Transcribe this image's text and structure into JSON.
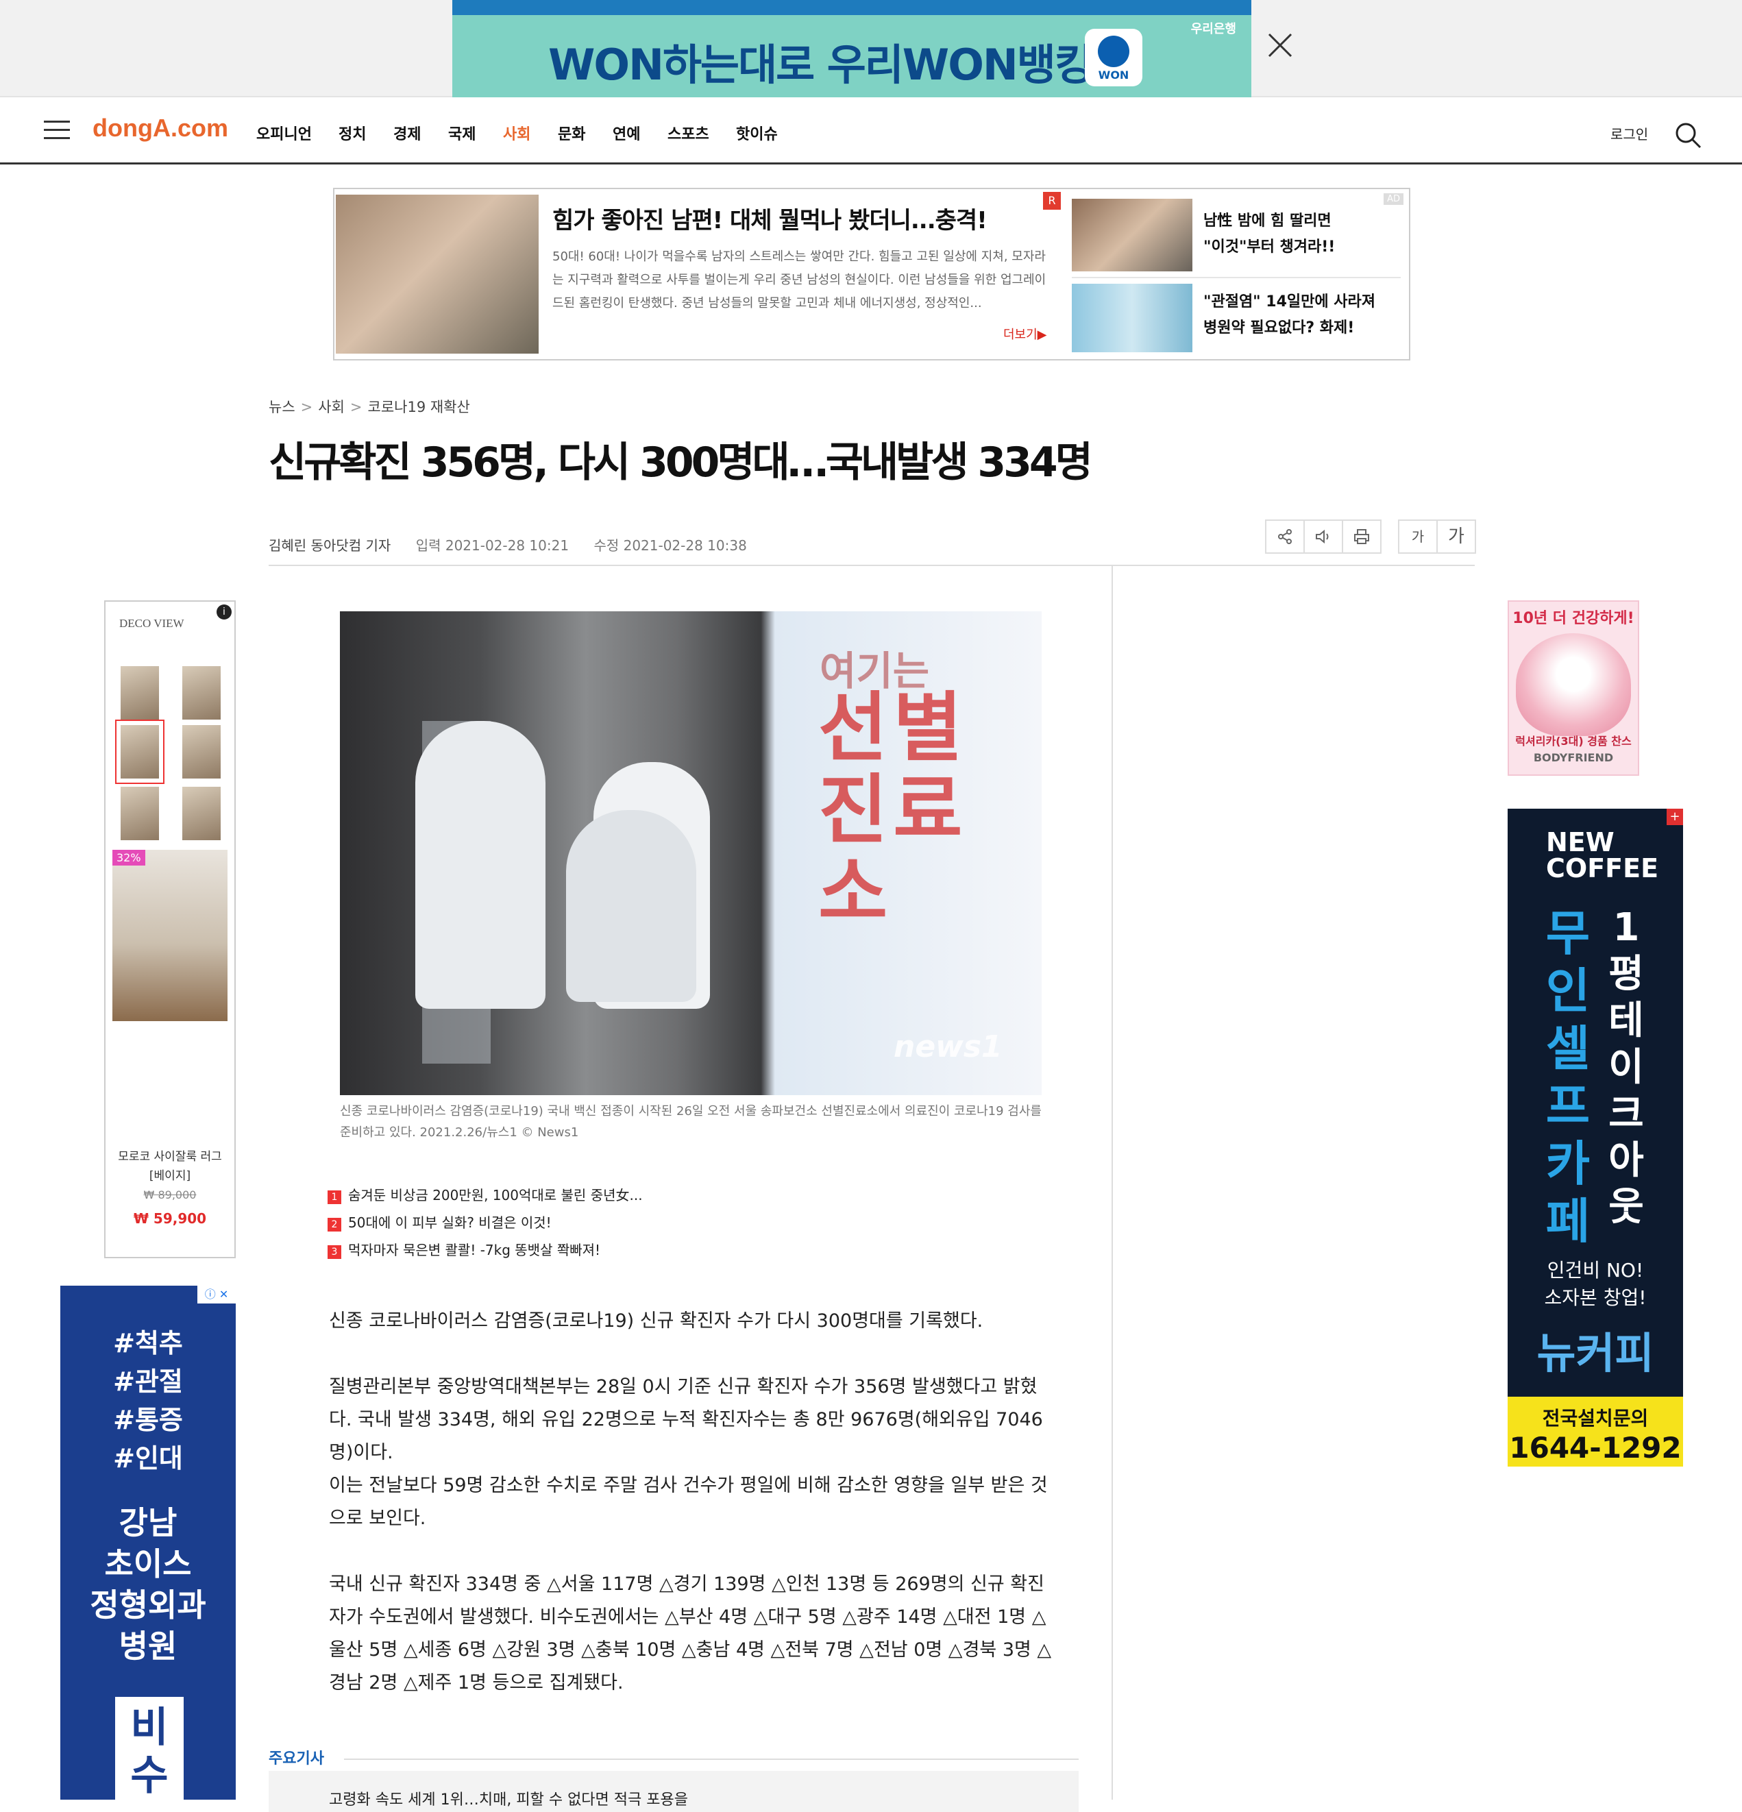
{
  "top_banner": {
    "text": "WON하는대로 우리WON뱅킹",
    "bank": "우리은행",
    "logo_text": "WON",
    "close_icon": "close-icon"
  },
  "nav": {
    "logo": "dongA.com",
    "menu": [
      "오피니언",
      "정치",
      "경제",
      "국제",
      "사회",
      "문화",
      "연예",
      "스포츠",
      "핫이슈"
    ],
    "active_index": 4,
    "login": "로그인",
    "accent_color": "#e8662d"
  },
  "top_ad": {
    "headline": "힘가 좋아진 남편! 대체 뭘먹나 봤더니...충격!",
    "description": "50대! 60대! 나이가 먹을수록 남자의 스트레스는 쌓여만 간다. 힘들고 고된 일상에 지쳐, 모자라는 지구력과 활력으로 사투를 벌이는게 우리 중년 남성의 현실이다. 이런 남성들을 위한 업그레이드된 홈런킹이 탄생했다. 중년 남성들의 말못할 고민과 체내 에너지생성, 정상적인...",
    "more": "더보기▶",
    "badge": "R",
    "ad_tag": "AD",
    "side1": "남性 밤에 힘 딸리면\n\"이것\"부터 챙겨라!!",
    "side2": "\"관절염\" 14일만에 사라져\n병원약 필요없다? 화제!"
  },
  "breadcrumb": [
    "뉴스",
    "사회",
    "코로나19 재확산"
  ],
  "article": {
    "headline": "신규확진 356명, 다시 300명대…국내발생 334명",
    "reporter": "김혜린 동아닷컴 기자",
    "published": "입력 2021-02-28 10:21",
    "modified": "수정 2021-02-28 10:38",
    "tools": {
      "small_font": "가",
      "large_font": "가"
    },
    "photo": {
      "sign_top": "여기는",
      "sign_main": "선별\n진료소",
      "watermark": "news1"
    },
    "caption": "신종 코로나바이러스 감염증(코로나19) 국내 백신 접종이 시작된 26일 오전 서울 송파보건소 선별진료소에서 의료진이 코로나19 검사를 준비하고 있다. 2021.2.26/뉴스1 © News1",
    "related": [
      {
        "n": "1",
        "text": "숨겨둔 비상금 200만원, 100억대로 불린 중년女..."
      },
      {
        "n": "2",
        "text": "50대에 이 피부 실화? 비결은 이것!"
      },
      {
        "n": "3",
        "text": "먹자마자 묵은변 콸콸! -7kg 똥뱃살 쫙빠져!"
      }
    ],
    "paragraphs": [
      "신종 코로나바이러스 감염증(코로나19) 신규 확진자 수가 다시 300명대를 기록했다.",
      "질병관리본부 중앙방역대책본부는 28일 0시 기준 신규 확진자 수가 356명 발생했다고 밝혔다. 국내 발생 334명, 해외 유입 22명으로 누적 확진자수는 총 8만 9676명(해외유입 7046명)이다.",
      "이는 전날보다 59명 감소한 수치로 주말 검사 건수가 평일에 비해 감소한 영향을 일부 받은 것으로 보인다.",
      "국내 신규 확진자 334명 중 △서울 117명 △경기 139명 △인천 13명 등 269명의 신규 확진자가 수도권에서 발생했다. 비수도권에서는 △부산 4명 △대구 5명 △광주 14명 △대전 1명 △울산 5명 △세종 6명 △강원 3명 △충북 10명 △충남 4명 △전북 7명 △전남 0명 △경북 3명 △경남 2명 △제주 1명 등으로 집계됐다."
    ]
  },
  "bottom": {
    "label": "주요기사",
    "item": "고령화 속도 세계 1위…치매, 피할 수 없다면 적극 포용을"
  },
  "left_ads": {
    "deco_brand": "DECO VIEW",
    "deco_info": "i",
    "discount": "32%",
    "product": "모로코 사이잘룩 러그[베이지]",
    "old_price": "₩ 89,000",
    "new_price": "₩ 59,900",
    "clinic_tags": "#척추\n#관절\n#통증\n#인대",
    "clinic_name": "강남\n초이스\n정형외과\n병원",
    "clinic_sub": "비\n수"
  },
  "right_ads": {
    "bf_title": "10년 더 건강하게!",
    "bf_line": "럭셔리카(3대) 경품 찬스",
    "bf_brand": "BODYFRIEND",
    "coffee_brand": "NEW\nCOFFEE",
    "coffee_col1": [
      "무",
      "인",
      "셀",
      "프",
      "카",
      "페"
    ],
    "coffee_col2": [
      "1",
      "평",
      "테",
      "이",
      "크",
      "아",
      "웃"
    ],
    "coffee_sub": "인건비 NO!\n소자본 창업!",
    "coffee_name": "뉴커피",
    "coffee_call_label": "전국설치문의",
    "coffee_phone": "1644-1292"
  }
}
